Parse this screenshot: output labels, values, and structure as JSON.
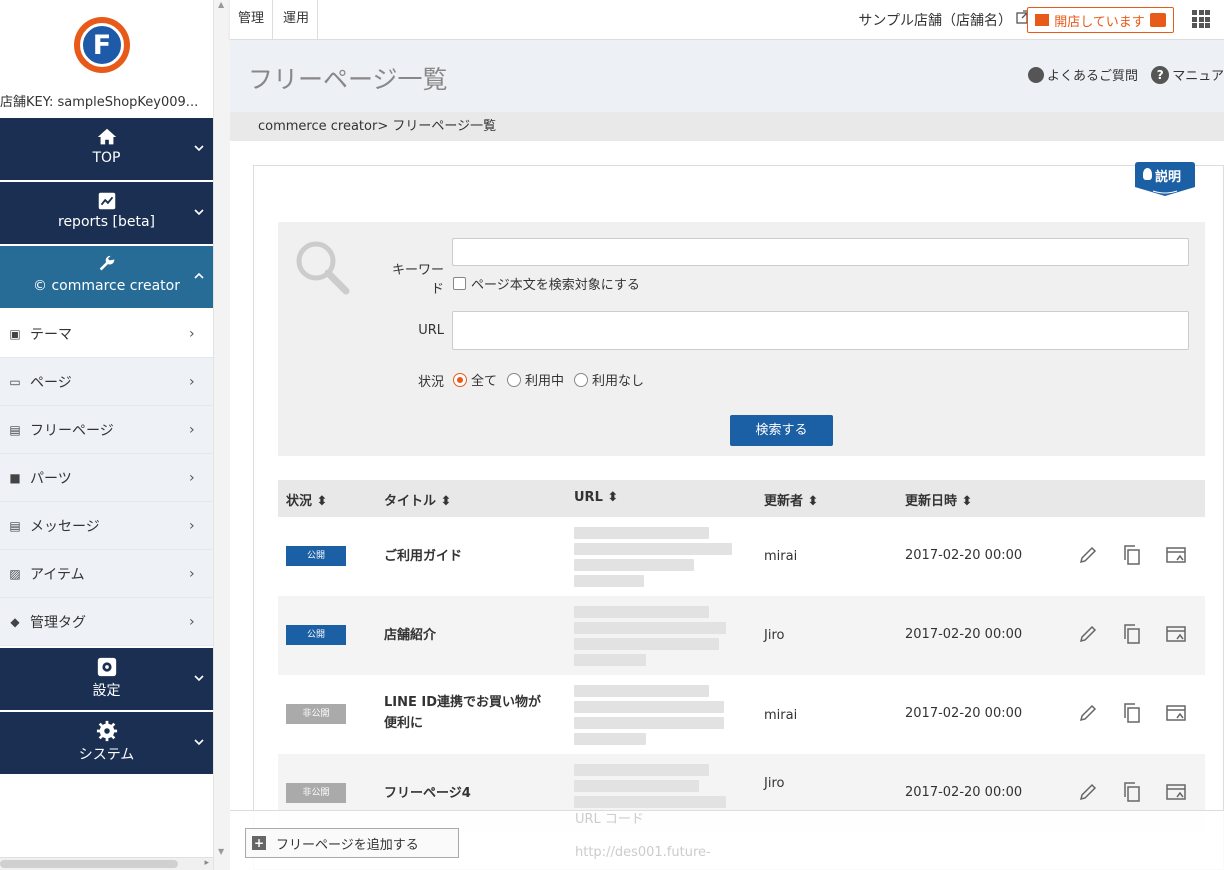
{
  "topbar": {
    "tabs": [
      "管理",
      "運用"
    ],
    "shop_name": "サンプル店舗（店舗名）",
    "open_label": "開店しています"
  },
  "sidebar": {
    "shop_key": "店舗KEY: sampleShopKey009...",
    "sections": [
      {
        "label": "TOP",
        "icon": "home-icon"
      },
      {
        "label": "reports [beta]",
        "icon": "chart-icon"
      },
      {
        "label": "commarce creator",
        "icon": "wrench-icon"
      },
      {
        "label": "設定",
        "icon": "settings-icon"
      },
      {
        "label": "システム",
        "icon": "gear-icon"
      }
    ],
    "sub_items": [
      "テーマ",
      "ページ",
      "フリーページ",
      "パーツ",
      "メッセージ",
      "アイテム",
      "管理タグ"
    ]
  },
  "header": {
    "title": "フリーページ一覧",
    "faq": "よくあるご質問",
    "manual": "マニュア"
  },
  "breadcrumb": "commerce creator> フリーページ一覧",
  "help_label": "説明",
  "search": {
    "keyword_label": "キーワード",
    "keyword_value": "",
    "body_checkbox": "ページ本文を検索対象にする",
    "url_label": "URL",
    "url_value": "",
    "status_label": "状況",
    "status_options": [
      "全て",
      "利用中",
      "利用なし"
    ],
    "selected_status": "全て",
    "submit": "検索する"
  },
  "table": {
    "headers": [
      "状況",
      "タイトル",
      "URL",
      "更新者",
      "更新日時"
    ],
    "rows": [
      {
        "status": "公開",
        "title": "ご利用ガイド",
        "updater": "mirai",
        "date": "2017-02-20 00:00"
      },
      {
        "status": "公開",
        "title": "店舗紹介",
        "updater": "Jiro",
        "date": "2017-02-20 00:00"
      },
      {
        "status": "非公開",
        "title": "LINE ID連携でお買い物が便利に",
        "updater": "mirai",
        "date": "2017-02-20 00:00"
      },
      {
        "status": "非公開",
        "title": "フリーページ4",
        "updater": "Jiro",
        "date": "2017-02-20 00:00"
      }
    ]
  },
  "footer": {
    "add_button": "フリーページを追加する",
    "ghost_url_code": "URL コード",
    "ghost_url": "http://des001.future-"
  },
  "colors": {
    "navy": "#1b2f52",
    "teal": "#276c96",
    "orange": "#e85a19",
    "blue": "#1b5fa5"
  }
}
